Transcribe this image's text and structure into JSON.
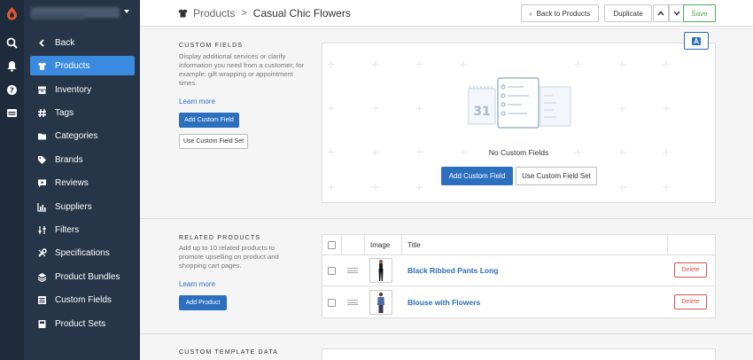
{
  "nav": {
    "items": [
      {
        "label": "Back",
        "icon": "chevron-left-icon"
      },
      {
        "label": "Products",
        "icon": "tshirt-icon",
        "active": true
      },
      {
        "label": "Inventory",
        "icon": "inventory-icon"
      },
      {
        "label": "Tags",
        "icon": "hashtag-icon"
      },
      {
        "label": "Categories",
        "icon": "folder-icon"
      },
      {
        "label": "Brands",
        "icon": "tag-icon"
      },
      {
        "label": "Reviews",
        "icon": "comment-icon"
      },
      {
        "label": "Suppliers",
        "icon": "chart-icon"
      },
      {
        "label": "Filters",
        "icon": "filter-icon"
      },
      {
        "label": "Specifications",
        "icon": "tools-icon"
      },
      {
        "label": "Product Bundles",
        "icon": "layers-icon"
      },
      {
        "label": "Custom Fields",
        "icon": "list-icon"
      },
      {
        "label": "Product Sets",
        "icon": "book-icon"
      }
    ]
  },
  "header": {
    "breadcrumb_parent": "Products",
    "breadcrumb_sep": ">",
    "breadcrumb_current": "Casual Chic Flowers",
    "back_label": "Back to Products",
    "duplicate_label": "Duplicate",
    "save_label": "Save"
  },
  "custom_fields": {
    "title": "CUSTOM FIELDS",
    "description": "Display additional services or clarify information you need from a customer; for example: gift wrapping or appointment times.",
    "learn_more": "Learn more",
    "add_label": "Add Custom Field",
    "use_set_label": "Use Custom Field Set",
    "empty_text": "No Custom Fields",
    "calendar_day": "31",
    "panel_add_label": "Add Custom Field",
    "panel_use_set_label": "Use Custom Field Set"
  },
  "related_products": {
    "title": "RELATED PRODUCTS",
    "description": "Add up to 10 related products to promote upselling on product and shopping cart pages.",
    "learn_more": "Learn more",
    "add_label": "Add Product",
    "columns": {
      "image": "Image",
      "title": "Title"
    },
    "rows": [
      {
        "title": "Black Ribbed Pants Long",
        "delete": "Delete"
      },
      {
        "title": "Blouse with Flowers",
        "delete": "Delete"
      }
    ]
  },
  "custom_template": {
    "title": "CUSTOM TEMPLATE DATA"
  },
  "colors": {
    "rail": "#1e2b3c",
    "sidebar": "#263548",
    "accent": "#3a8be0",
    "primary_button": "#2c6fbf",
    "save": "#4caf50",
    "delete": "#d9534f"
  }
}
